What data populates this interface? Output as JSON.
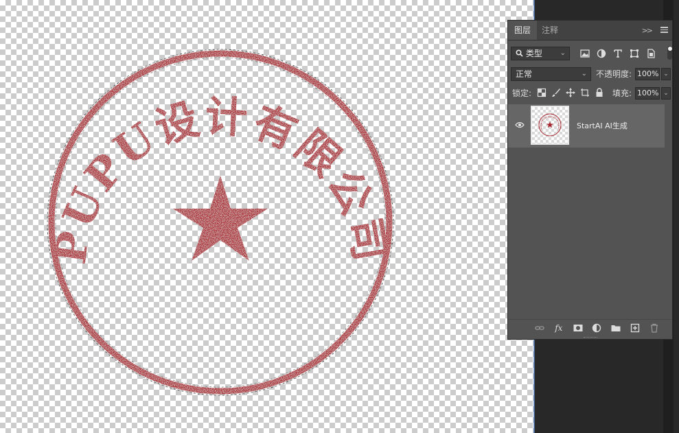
{
  "canvas": {
    "stamp": {
      "arc_text": "PUPU设计有限公司",
      "ink_color": "#a8232b",
      "star_icon": "five-point-star"
    }
  },
  "layers_panel": {
    "tabs": [
      {
        "label": "图层",
        "active": true
      },
      {
        "label": "注释",
        "active": false
      }
    ],
    "tab_more_glyph": ">>",
    "filter": {
      "kind_label": "类型",
      "icons": [
        "image-filter-icon",
        "adjustment-filter-icon",
        "type-filter-icon",
        "shape-filter-icon",
        "smart-object-filter-icon"
      ]
    },
    "blend_mode": "正常",
    "opacity_label": "不透明度:",
    "opacity_value": "100%",
    "lock_label": "锁定:",
    "lock_icons": [
      "lock-transparent-pixels-icon",
      "lock-image-pixels-icon",
      "lock-position-icon",
      "lock-artboard-icon",
      "lock-all-icon"
    ],
    "fill_label": "填充:",
    "fill_value": "100%",
    "layers": [
      {
        "name": "StartAI AI生成",
        "visible": true,
        "selected": true
      }
    ],
    "bottom_icons": [
      "link-layers-icon",
      "fx-icon",
      "add-mask-icon",
      "adjustment-layer-icon",
      "new-group-icon",
      "new-layer-icon",
      "trash-icon"
    ],
    "bottom_fx_label": "fx"
  },
  "colors": {
    "panel_bg": "#535353",
    "tab_bar": "#424242",
    "selected_layer": "#666666",
    "workspace_dark": "#282828"
  }
}
